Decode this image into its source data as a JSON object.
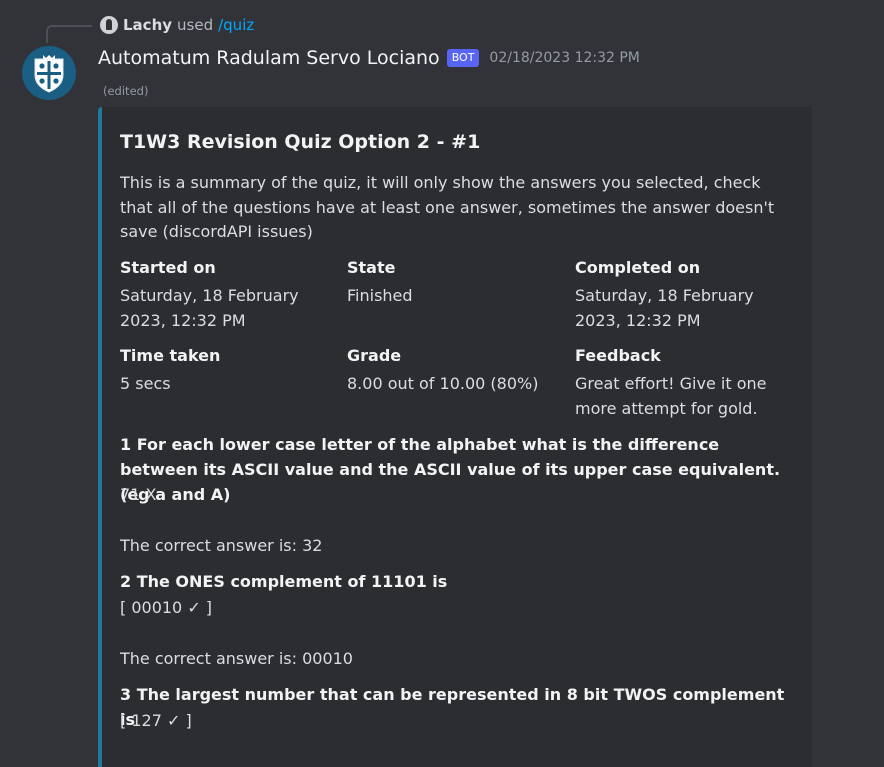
{
  "reply": {
    "user": "Lachy",
    "used": "used",
    "command": "/quiz"
  },
  "message": {
    "bot_name": "Automatum Radulam Servo Lociano",
    "bot_tag": "BOT",
    "timestamp": "02/18/2023 12:32 PM",
    "edited": "(edited)"
  },
  "embed": {
    "accent_color": "#1e7a9c",
    "title": "T1W3 Revision Quiz Option 2 - #1",
    "description": "This is a summary of the quiz, it will only show the answers you selected, check that all of the questions have at least one answer, sometimes the answer doesn't save (discordAPI issues)",
    "fields": [
      {
        "name": "Started on",
        "value": "Saturday, 18 February 2023, 12:32 PM"
      },
      {
        "name": "State",
        "value": "Finished"
      },
      {
        "name": "Completed on",
        "value": "Saturday, 18 February 2023, 12:32 PM"
      },
      {
        "name": "Time taken",
        "value": "5 secs"
      },
      {
        "name": "Grade",
        "value": "8.00 out of 10.00 (80%)"
      },
      {
        "name": "Feedback",
        "value": "Great effort! Give it one more attempt for gold."
      }
    ],
    "questions": [
      {
        "title": "1 For each lower case letter of the alphabet what is the difference between its ASCII value and the ASCII value of its upper case equivalent.  (eg a and A)",
        "answer": "71 X",
        "correct": "The correct answer is: 32"
      },
      {
        "title": "2 The ONES complement of   11101  is",
        "answer": "[ 00010 ✓ ]",
        "correct": "The correct answer is: 00010"
      },
      {
        "title": "3 The largest number that can be represented in 8 bit TWOS complement is",
        "answer": "[ 127 ✓ ]"
      }
    ]
  }
}
